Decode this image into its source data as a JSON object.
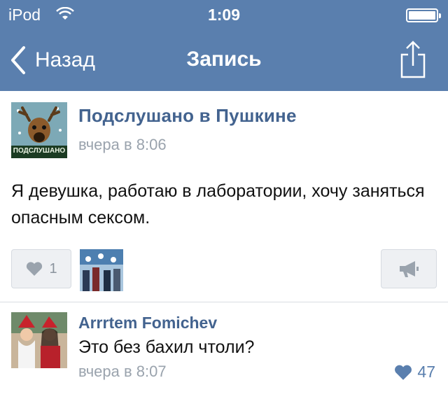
{
  "status_bar": {
    "carrier": "iPod",
    "time": "1:09"
  },
  "nav": {
    "back_label": "Назад",
    "title": "Запись"
  },
  "post": {
    "group_name": "Подслушано в Пушкине",
    "avatar_caption": "ПОДСЛУШАНО",
    "time": "вчера в 8:06",
    "text": "Я девушка, работаю в лаборатории, хочу заняться опасным сексом.",
    "likes_count": "1"
  },
  "comment": {
    "author": "Arrrtem Fomichev",
    "text": "Это без бахил чтоли?",
    "time": "вчера в 8:07",
    "likes_count": "47"
  },
  "colors": {
    "header": "#5a7fae",
    "link": "#43638f",
    "meta": "#9aa3ad",
    "accent": "#5a7fae"
  },
  "icons": [
    "wifi-icon",
    "battery-icon",
    "back-chevron-icon",
    "share-icon",
    "heart-icon",
    "megaphone-icon"
  ]
}
